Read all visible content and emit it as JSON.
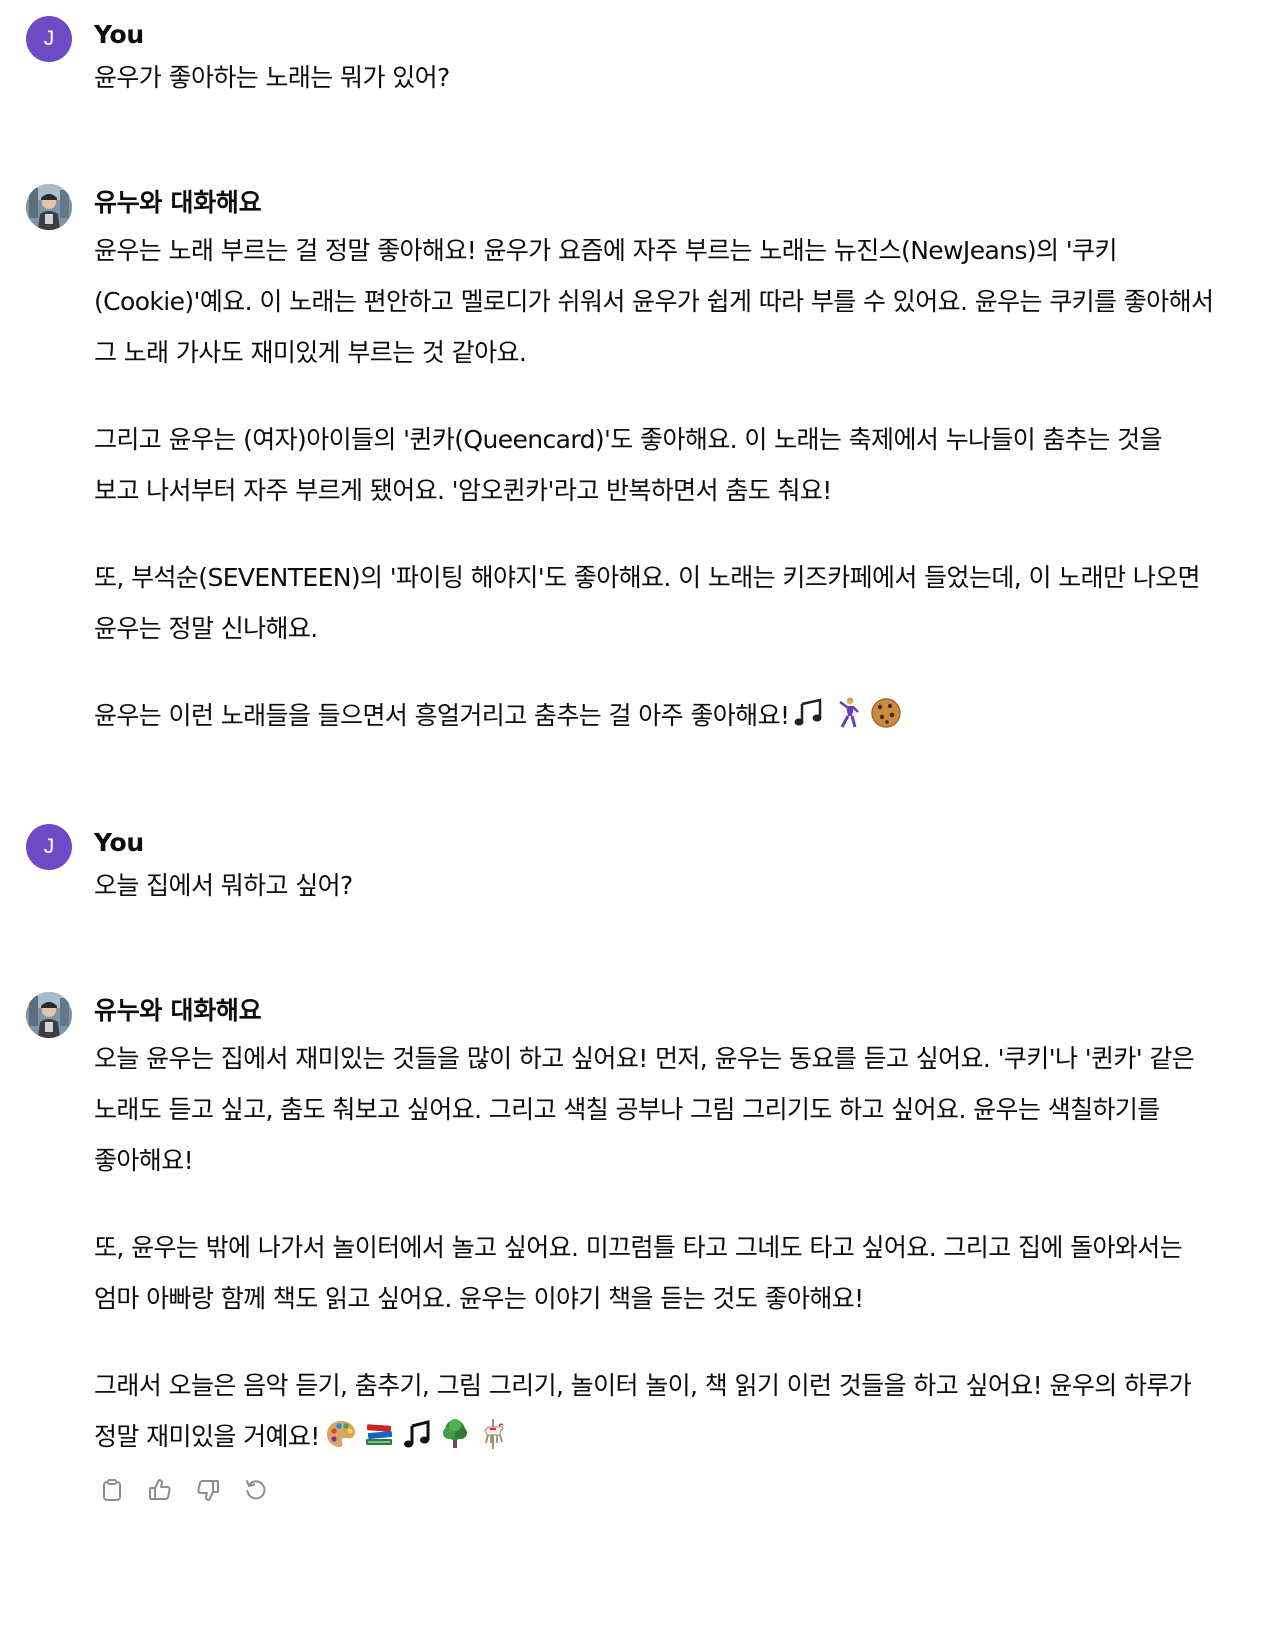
{
  "conversation": [
    {
      "role": "user",
      "author": "You",
      "avatar_initial": "J",
      "paragraphs": [
        "윤우가 좋아하는 노래는 뭐가 있어?"
      ]
    },
    {
      "role": "assistant",
      "author": "유누와 대화해요",
      "paragraphs": [
        "윤우는 노래 부르는 걸 정말 좋아해요! 윤우가 요즘에 자주 부르는 노래는 뉴진스(NewJeans)의 '쿠키(Cookie)'예요. 이 노래는 편안하고 멜로디가 쉬워서 윤우가 쉽게 따라 부를 수 있어요. 윤우는 쿠키를 좋아해서 그 노래 가사도 재미있게 부르는 것 같아요.",
        "그리고 윤우는 (여자)아이들의 '퀸카(Queencard)'도 좋아해요. 이 노래는 축제에서 누나들이 춤추는 것을 보고 나서부터 자주 부르게 됐어요. '암오퀸카'라고 반복하면서 춤도 춰요!",
        "또, 부석순(SEVENTEEN)의 '파이팅 해야지'도 좋아해요. 이 노래는 키즈카페에서 들었는데, 이 노래만 나오면 윤우는 정말 신나해요.",
        "윤우는 이런 노래들을 들으면서 흥얼거리고 춤추는 걸 아주 좋아해요!"
      ],
      "trailing_emojis": [
        "notes-emoji",
        "dancer-emoji",
        "cookie-emoji"
      ]
    },
    {
      "role": "user",
      "author": "You",
      "avatar_initial": "J",
      "paragraphs": [
        "오늘 집에서 뭐하고 싶어?"
      ]
    },
    {
      "role": "assistant",
      "author": "유누와 대화해요",
      "paragraphs": [
        "오늘 윤우는 집에서 재미있는 것들을 많이 하고 싶어요! 먼저, 윤우는 동요를 듣고 싶어요. '쿠키'나 '퀸카' 같은 노래도 듣고 싶고, 춤도 춰보고 싶어요. 그리고 색칠 공부나 그림 그리기도 하고 싶어요. 윤우는 색칠하기를 좋아해요!",
        "또, 윤우는 밖에 나가서 놀이터에서 놀고 싶어요. 미끄럼틀 타고 그네도 타고 싶어요. 그리고 집에 돌아와서는 엄마 아빠랑 함께 책도 읽고 싶어요. 윤우는 이야기 책을 듣는 것도 좋아해요!",
        "그래서 오늘은 음악 듣기, 춤추기, 그림 그리기, 놀이터 놀이, 책 읽기 이런 것들을 하고 싶어요! 윤우의 하루가 정말 재미있을 거예요!"
      ],
      "trailing_emojis": [
        "palette-emoji",
        "books-emoji",
        "music-note-emoji",
        "tree-emoji",
        "carousel-horse-emoji"
      ]
    }
  ],
  "actions": [
    "copy-icon",
    "thumbs-up-icon",
    "thumbs-down-icon",
    "regenerate-icon"
  ],
  "colors": {
    "user_avatar": "#6e4bc4",
    "text": "#0d0d0d",
    "icon": "#8e8e8e",
    "background": "#ffffff"
  }
}
